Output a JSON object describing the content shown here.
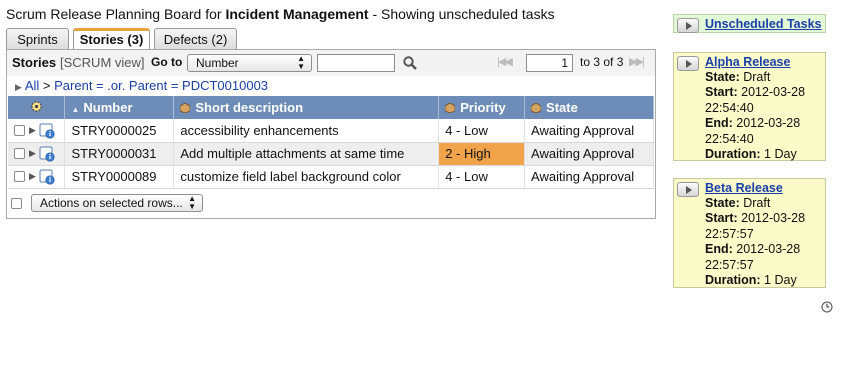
{
  "header": {
    "title_prefix": "Scrum Release Planning Board for",
    "title_bold": "Incident Management",
    "title_suffix": "- Showing unscheduled tasks"
  },
  "tabs": [
    {
      "label": "Sprints",
      "active": false
    },
    {
      "label": "Stories (3)",
      "active": true
    },
    {
      "label": "Defects (2)",
      "active": false
    }
  ],
  "toolbar": {
    "title": "Stories",
    "view": "[SCRUM view]",
    "goto_label": "Go to",
    "goto_select": "Number",
    "search_value": "",
    "page_value": "1",
    "page_of": "to 3 of 3"
  },
  "breadcrumb": {
    "all": "All",
    "separator": ">",
    "filter": "Parent = .or. Parent = PDCT0010003"
  },
  "table": {
    "columns": [
      "Number",
      "Short description",
      "Priority",
      "State"
    ],
    "rows": [
      {
        "number": "STRY0000025",
        "description": "accessibility enhancements",
        "priority": "4 - Low",
        "state": "Awaiting Approval",
        "highlight": false
      },
      {
        "number": "STRY0000031",
        "description": "Add multiple attachments at same time",
        "priority": "2 - High",
        "state": "Awaiting Approval",
        "highlight": true
      },
      {
        "number": "STRY0000089",
        "description": "customize field label background color",
        "priority": "4 - Low",
        "state": "Awaiting Approval",
        "highlight": false
      }
    ]
  },
  "actions": {
    "label": "Actions on selected rows..."
  },
  "cards": {
    "unscheduled": {
      "title": "Unscheduled Tasks"
    },
    "alpha": {
      "title": "Alpha Release",
      "state_label": "State:",
      "state": "Draft",
      "start_label": "Start:",
      "start_date": "2012-03-28",
      "start_time": "22:54:40",
      "end_label": "End:",
      "end_date": "2012-03-28",
      "end_time": "22:54:40",
      "duration_label": "Duration:",
      "duration": "1 Day"
    },
    "beta": {
      "title": "Beta Release",
      "state_label": "State:",
      "state": "Draft",
      "start_label": "Start:",
      "start_date": "2012-03-28",
      "start_time": "22:57:57",
      "end_label": "End:",
      "end_date": "2012-03-28",
      "end_time": "22:57:57",
      "duration_label": "Duration:",
      "duration": "1 Day"
    }
  },
  "colors": {
    "header_blue": "#6d8db8",
    "tab_accent": "#e8a33c",
    "high_priority": "#f0a34a",
    "card_yellow": "#fbfbc9",
    "card_green": "#e3f8d6",
    "link_blue": "#1a3fa8"
  }
}
